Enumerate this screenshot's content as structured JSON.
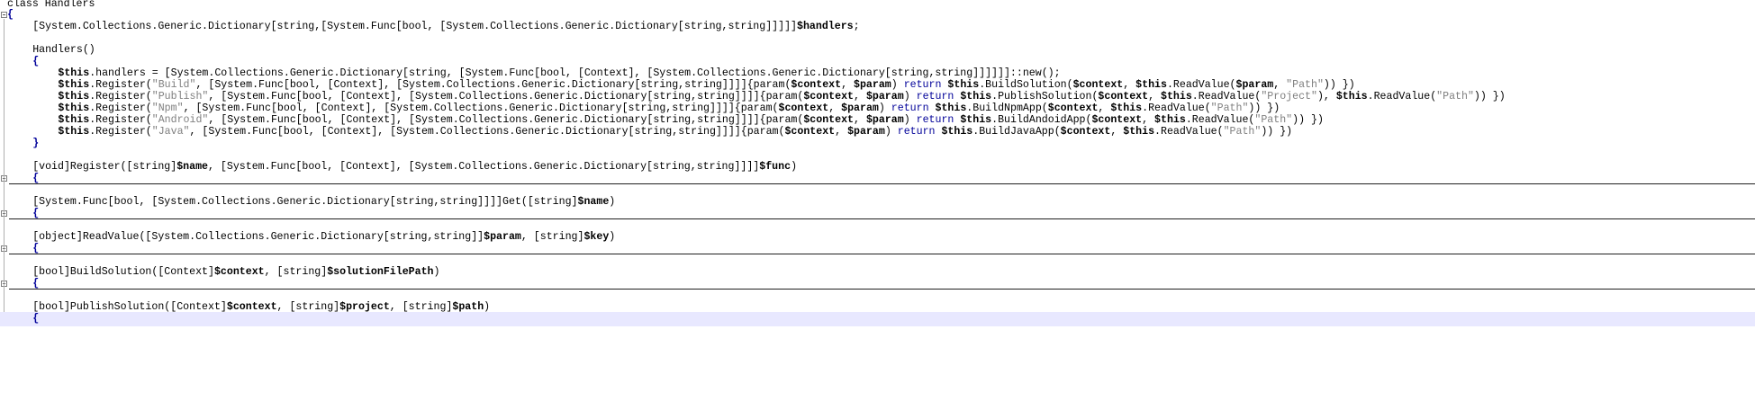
{
  "code_lines": [
    {
      "indent": "",
      "tokens": [
        {
          "t": "class Handlers",
          "c": ""
        }
      ]
    },
    {
      "indent": "",
      "tokens": [
        {
          "t": "{",
          "c": "brace"
        }
      ]
    },
    {
      "indent": "    ",
      "tokens": [
        {
          "t": "[System.Collections.Generic.Dictionary[string,[System.Func[bool, [System.Collections.Generic.Dictionary[string,string]]]]]",
          "c": ""
        },
        {
          "t": "$handlers",
          "c": "var"
        },
        {
          "t": ";",
          "c": ""
        }
      ]
    },
    {
      "indent": "",
      "tokens": []
    },
    {
      "indent": "    ",
      "tokens": [
        {
          "t": "Handlers()",
          "c": ""
        }
      ]
    },
    {
      "indent": "    ",
      "tokens": [
        {
          "t": "{",
          "c": "brace"
        }
      ]
    },
    {
      "indent": "        ",
      "tokens": [
        {
          "t": "$this",
          "c": "var"
        },
        {
          "t": ".handlers = [System.Collections.Generic.Dictionary[string, [System.Func[bool, [Context], [System.Collections.Generic.Dictionary[string,string]]]]]]::new();",
          "c": ""
        }
      ]
    },
    {
      "indent": "        ",
      "tokens": [
        {
          "t": "$this",
          "c": "var"
        },
        {
          "t": ".Register(",
          "c": ""
        },
        {
          "t": "\"Build\"",
          "c": "str"
        },
        {
          "t": ", [System.Func[bool, [Context], [System.Collections.Generic.Dictionary[string,string]]]]{param(",
          "c": ""
        },
        {
          "t": "$context",
          "c": "var"
        },
        {
          "t": ", ",
          "c": ""
        },
        {
          "t": "$param",
          "c": "var"
        },
        {
          "t": ") ",
          "c": ""
        },
        {
          "t": "return",
          "c": "kw"
        },
        {
          "t": " ",
          "c": ""
        },
        {
          "t": "$this",
          "c": "var"
        },
        {
          "t": ".BuildSolution(",
          "c": ""
        },
        {
          "t": "$context",
          "c": "var"
        },
        {
          "t": ", ",
          "c": ""
        },
        {
          "t": "$this",
          "c": "var"
        },
        {
          "t": ".ReadValue(",
          "c": ""
        },
        {
          "t": "$param",
          "c": "var"
        },
        {
          "t": ", ",
          "c": ""
        },
        {
          "t": "\"Path\"",
          "c": "str"
        },
        {
          "t": ")) })",
          "c": ""
        }
      ]
    },
    {
      "indent": "        ",
      "tokens": [
        {
          "t": "$this",
          "c": "var"
        },
        {
          "t": ".Register(",
          "c": ""
        },
        {
          "t": "\"Publish\"",
          "c": "str"
        },
        {
          "t": ", [System.Func[bool, [Context], [System.Collections.Generic.Dictionary[string,string]]]]{param(",
          "c": ""
        },
        {
          "t": "$context",
          "c": "var"
        },
        {
          "t": ", ",
          "c": ""
        },
        {
          "t": "$param",
          "c": "var"
        },
        {
          "t": ") ",
          "c": ""
        },
        {
          "t": "return",
          "c": "kw"
        },
        {
          "t": " ",
          "c": ""
        },
        {
          "t": "$this",
          "c": "var"
        },
        {
          "t": ".PublishSolution(",
          "c": ""
        },
        {
          "t": "$context",
          "c": "var"
        },
        {
          "t": ", ",
          "c": ""
        },
        {
          "t": "$this",
          "c": "var"
        },
        {
          "t": ".ReadValue(",
          "c": ""
        },
        {
          "t": "\"Project\"",
          "c": "str"
        },
        {
          "t": "), ",
          "c": ""
        },
        {
          "t": "$this",
          "c": "var"
        },
        {
          "t": ".ReadValue(",
          "c": ""
        },
        {
          "t": "\"Path\"",
          "c": "str"
        },
        {
          "t": ")) })",
          "c": ""
        }
      ]
    },
    {
      "indent": "        ",
      "tokens": [
        {
          "t": "$this",
          "c": "var"
        },
        {
          "t": ".Register(",
          "c": ""
        },
        {
          "t": "\"Npm\"",
          "c": "str"
        },
        {
          "t": ", [System.Func[bool, [Context], [System.Collections.Generic.Dictionary[string,string]]]]{param(",
          "c": ""
        },
        {
          "t": "$context",
          "c": "var"
        },
        {
          "t": ", ",
          "c": ""
        },
        {
          "t": "$param",
          "c": "var"
        },
        {
          "t": ") ",
          "c": ""
        },
        {
          "t": "return",
          "c": "kw"
        },
        {
          "t": " ",
          "c": ""
        },
        {
          "t": "$this",
          "c": "var"
        },
        {
          "t": ".BuildNpmApp(",
          "c": ""
        },
        {
          "t": "$context",
          "c": "var"
        },
        {
          "t": ", ",
          "c": ""
        },
        {
          "t": "$this",
          "c": "var"
        },
        {
          "t": ".ReadValue(",
          "c": ""
        },
        {
          "t": "\"Path\"",
          "c": "str"
        },
        {
          "t": ")) })",
          "c": ""
        }
      ]
    },
    {
      "indent": "        ",
      "tokens": [
        {
          "t": "$this",
          "c": "var"
        },
        {
          "t": ".Register(",
          "c": ""
        },
        {
          "t": "\"Android\"",
          "c": "str"
        },
        {
          "t": ", [System.Func[bool, [Context], [System.Collections.Generic.Dictionary[string,string]]]]{param(",
          "c": ""
        },
        {
          "t": "$context",
          "c": "var"
        },
        {
          "t": ", ",
          "c": ""
        },
        {
          "t": "$param",
          "c": "var"
        },
        {
          "t": ") ",
          "c": ""
        },
        {
          "t": "return",
          "c": "kw"
        },
        {
          "t": " ",
          "c": ""
        },
        {
          "t": "$this",
          "c": "var"
        },
        {
          "t": ".BuildAndoidApp(",
          "c": ""
        },
        {
          "t": "$context",
          "c": "var"
        },
        {
          "t": ", ",
          "c": ""
        },
        {
          "t": "$this",
          "c": "var"
        },
        {
          "t": ".ReadValue(",
          "c": ""
        },
        {
          "t": "\"Path\"",
          "c": "str"
        },
        {
          "t": ")) })",
          "c": ""
        }
      ]
    },
    {
      "indent": "        ",
      "tokens": [
        {
          "t": "$this",
          "c": "var"
        },
        {
          "t": ".Register(",
          "c": ""
        },
        {
          "t": "\"Java\"",
          "c": "str"
        },
        {
          "t": ", [System.Func[bool, [Context], [System.Collections.Generic.Dictionary[string,string]]]]{param(",
          "c": ""
        },
        {
          "t": "$context",
          "c": "var"
        },
        {
          "t": ", ",
          "c": ""
        },
        {
          "t": "$param",
          "c": "var"
        },
        {
          "t": ") ",
          "c": ""
        },
        {
          "t": "return",
          "c": "kw"
        },
        {
          "t": " ",
          "c": ""
        },
        {
          "t": "$this",
          "c": "var"
        },
        {
          "t": ".BuildJavaApp(",
          "c": ""
        },
        {
          "t": "$context",
          "c": "var"
        },
        {
          "t": ", ",
          "c": ""
        },
        {
          "t": "$this",
          "c": "var"
        },
        {
          "t": ".ReadValue(",
          "c": ""
        },
        {
          "t": "\"Path\"",
          "c": "str"
        },
        {
          "t": ")) })",
          "c": ""
        }
      ]
    },
    {
      "indent": "    ",
      "tokens": [
        {
          "t": "}",
          "c": "brace"
        }
      ]
    },
    {
      "indent": "",
      "tokens": []
    },
    {
      "indent": "    ",
      "tokens": [
        {
          "t": "[void]Register([string]",
          "c": ""
        },
        {
          "t": "$name",
          "c": "var"
        },
        {
          "t": ", [System.Func[bool, [Context], [System.Collections.Generic.Dictionary[string,string]]]]",
          "c": ""
        },
        {
          "t": "$func",
          "c": "var"
        },
        {
          "t": ")",
          "c": ""
        }
      ]
    },
    {
      "indent": "    ",
      "tokens": [
        {
          "t": "{",
          "c": "brace"
        }
      ]
    },
    {
      "indent": "",
      "tokens": []
    },
    {
      "indent": "    ",
      "tokens": [
        {
          "t": "[System.Func[bool, [System.Collections.Generic.Dictionary[string,string]]]]Get([string]",
          "c": ""
        },
        {
          "t": "$name",
          "c": "var"
        },
        {
          "t": ")",
          "c": ""
        }
      ]
    },
    {
      "indent": "    ",
      "tokens": [
        {
          "t": "{",
          "c": "brace"
        }
      ]
    },
    {
      "indent": "",
      "tokens": []
    },
    {
      "indent": "    ",
      "tokens": [
        {
          "t": "[object]ReadValue([System.Collections.Generic.Dictionary[string,string]]",
          "c": ""
        },
        {
          "t": "$param",
          "c": "var"
        },
        {
          "t": ", [string]",
          "c": ""
        },
        {
          "t": "$key",
          "c": "var"
        },
        {
          "t": ")",
          "c": ""
        }
      ]
    },
    {
      "indent": "    ",
      "tokens": [
        {
          "t": "{",
          "c": "brace"
        }
      ]
    },
    {
      "indent": "",
      "tokens": []
    },
    {
      "indent": "    ",
      "tokens": [
        {
          "t": "[bool]BuildSolution([Context]",
          "c": ""
        },
        {
          "t": "$context",
          "c": "var"
        },
        {
          "t": ", [string]",
          "c": ""
        },
        {
          "t": "$solutionFilePath",
          "c": "var"
        },
        {
          "t": ")",
          "c": ""
        }
      ]
    },
    {
      "indent": "    ",
      "tokens": [
        {
          "t": "{",
          "c": "brace"
        }
      ]
    },
    {
      "indent": "",
      "tokens": []
    },
    {
      "indent": "    ",
      "tokens": [
        {
          "t": "[bool]PublishSolution([Context]",
          "c": ""
        },
        {
          "t": "$context",
          "c": "var"
        },
        {
          "t": ", [string]",
          "c": ""
        },
        {
          "t": "$project",
          "c": "var"
        },
        {
          "t": ", [string]",
          "c": ""
        },
        {
          "t": "$path",
          "c": "var"
        },
        {
          "t": ")",
          "c": ""
        }
      ]
    },
    {
      "indent": "    ",
      "tokens": [
        {
          "t": "{",
          "c": "brace"
        }
      ]
    }
  ],
  "colors": {
    "keyword": "#000099",
    "string": "#808080",
    "current_line": "#e8e8ff",
    "fold_marker_active": "#d03030"
  }
}
